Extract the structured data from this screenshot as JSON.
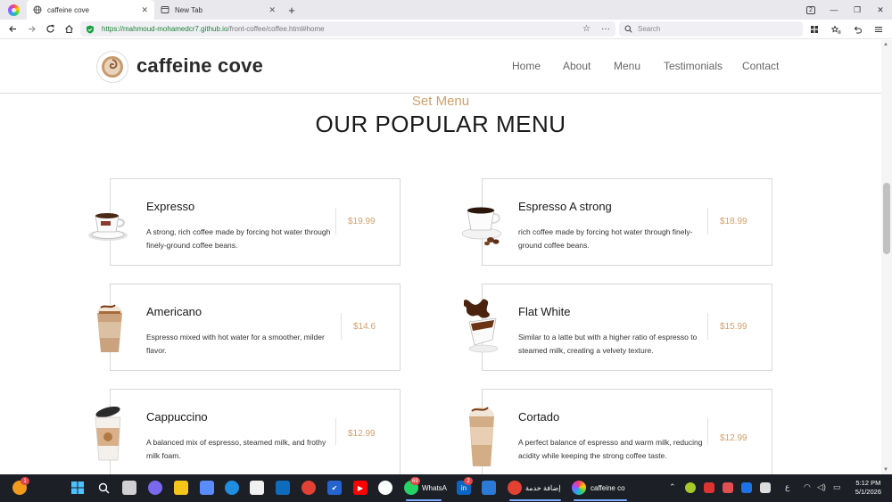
{
  "browser": {
    "tabs": [
      {
        "label": "caffeine cove",
        "active": true
      },
      {
        "label": "New Tab",
        "active": false
      }
    ],
    "url_host": "https://mahmoud-mohamedcr7.github.io",
    "url_path": "/front-coffee/coffee.html#home",
    "search_placeholder": "Search",
    "window_badge": "2"
  },
  "site": {
    "brand": "caffeine cove",
    "nav": [
      "Home",
      "About",
      "Menu",
      "Testimonials",
      "Contact"
    ],
    "section_subtitle": "Set Menu",
    "section_title": "OUR POPULAR MENU",
    "menu_items": [
      {
        "name": "Expresso",
        "description": "A strong, rich coffee made by forcing hot water through finely-ground coffee beans.",
        "price": "$19.99",
        "image": "espresso-cup-image"
      },
      {
        "name": "Espresso A strong",
        "description": "rich coffee made by forcing hot water through finely-ground coffee beans.",
        "price": "$18.99",
        "image": "espresso-cup-beans-image"
      },
      {
        "name": "Americano",
        "description": "Espresso mixed with hot water for a smoother, milder flavor.",
        "price": "$14.6",
        "image": "iced-coffee-image"
      },
      {
        "name": "Flat White",
        "description": "Similar to a latte but with a higher ratio of espresso to steamed milk, creating a velvety texture.",
        "price": "$15.99",
        "image": "coffee-splash-image"
      },
      {
        "name": "Cappuccino",
        "description": "A balanced mix of espresso, steamed milk, and frothy milk foam.",
        "price": "$12.99",
        "image": "takeaway-cup-image"
      },
      {
        "name": "Cortado",
        "description": "A perfect balance of espresso and warm milk, reducing acidity while keeping the strong coffee taste.",
        "price": "$12.99",
        "image": "frappe-cup-image"
      }
    ]
  },
  "taskbar": {
    "whatsapp_label": "WhatsA",
    "whatsapp_badge": "69",
    "linkedin_badge": "2",
    "chrome_label": "إضافة خدمة",
    "browser_label": "caffeine co",
    "lang": "ع",
    "time": "5:12 PM",
    "date": "5/1/2026"
  },
  "colors": {
    "accent": "#d1a06a",
    "taskbar": "#1c1f26"
  }
}
